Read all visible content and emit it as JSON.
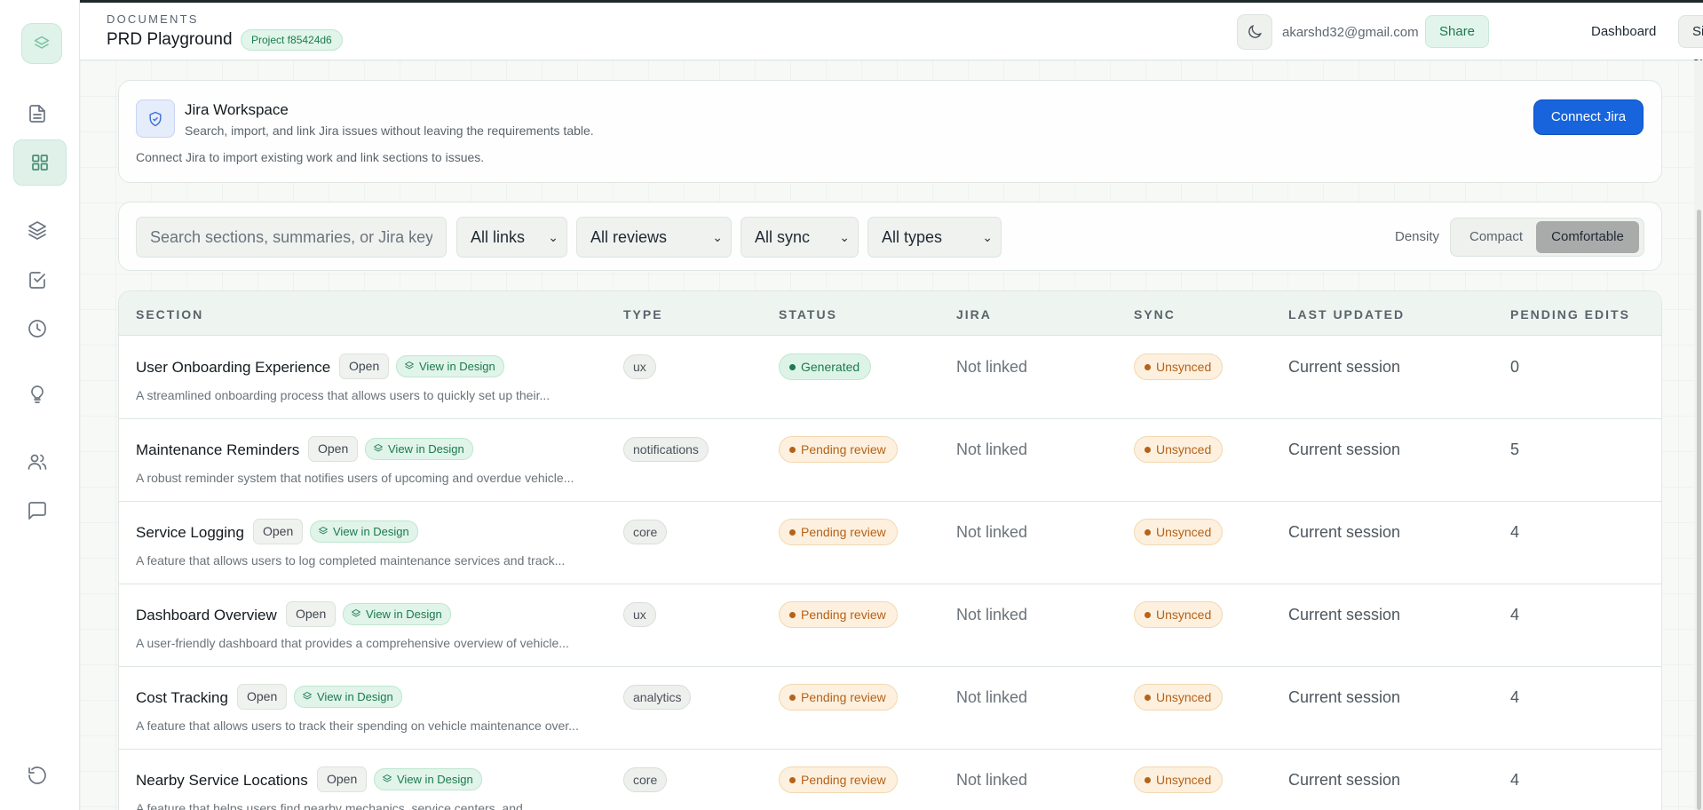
{
  "header": {
    "breadcrumb": "DOCUMENTS",
    "title": "PRD Playground",
    "project_badge": "Project f85424d6",
    "email": "akarshd32@gmail.com",
    "share_label": "Share",
    "dashboard_label": "Dashboard",
    "signout_label": "Sign out",
    "theme_icon": "moon-icon"
  },
  "sidebar": {
    "logo_icon": "layers-logo-icon",
    "items": [
      {
        "icon": "document-icon",
        "active": false
      },
      {
        "icon": "grid-icon",
        "active": true
      },
      {
        "icon": "layers-icon",
        "active": false
      },
      {
        "icon": "checklist-icon",
        "active": false
      },
      {
        "icon": "clock-icon",
        "active": false
      },
      {
        "icon": "lightbulb-icon",
        "active": false
      },
      {
        "icon": "users-icon",
        "active": false
      },
      {
        "icon": "chat-icon",
        "active": false
      },
      {
        "icon": "undo-icon",
        "active": false
      }
    ]
  },
  "jira": {
    "title": "Jira Workspace",
    "subtitle": "Search, import, and link Jira issues without leaving the requirements table.",
    "note": "Connect Jira to import existing work and link sections to issues.",
    "connect_label": "Connect Jira"
  },
  "filters": {
    "search_placeholder": "Search sections, summaries, or Jira keys",
    "links": "All links",
    "reviews": "All reviews",
    "sync": "All sync",
    "types": "All types",
    "density_label": "Density",
    "density_options": [
      "Compact",
      "Comfortable"
    ],
    "density_selected": "Comfortable"
  },
  "table": {
    "columns": [
      "SECTION",
      "TYPE",
      "STATUS",
      "JIRA",
      "SYNC",
      "LAST UPDATED",
      "PENDING EDITS"
    ],
    "open_label": "Open",
    "design_label": "View in Design",
    "rows": [
      {
        "title": "User Onboarding Experience",
        "summary": "A streamlined onboarding process that allows users to quickly set up their...",
        "type": "ux",
        "status": "Generated",
        "jira": "Not linked",
        "sync": "Unsynced",
        "updated": "Current session",
        "pending": "0"
      },
      {
        "title": "Maintenance Reminders",
        "summary": "A robust reminder system that notifies users of upcoming and overdue vehicle...",
        "type": "notifications",
        "status": "Pending review",
        "jira": "Not linked",
        "sync": "Unsynced",
        "updated": "Current session",
        "pending": "5"
      },
      {
        "title": "Service Logging",
        "summary": "A feature that allows users to log completed maintenance services and track...",
        "type": "core",
        "status": "Pending review",
        "jira": "Not linked",
        "sync": "Unsynced",
        "updated": "Current session",
        "pending": "4"
      },
      {
        "title": "Dashboard Overview",
        "summary": "A user-friendly dashboard that provides a comprehensive overview of vehicle...",
        "type": "ux",
        "status": "Pending review",
        "jira": "Not linked",
        "sync": "Unsynced",
        "updated": "Current session",
        "pending": "4"
      },
      {
        "title": "Cost Tracking",
        "summary": "A feature that allows users to track their spending on vehicle maintenance over...",
        "type": "analytics",
        "status": "Pending review",
        "jira": "Not linked",
        "sync": "Unsynced",
        "updated": "Current session",
        "pending": "4"
      },
      {
        "title": "Nearby Service Locations",
        "summary": "A feature that helps users find nearby mechanics, service centers, and...",
        "type": "core",
        "status": "Pending review",
        "jira": "Not linked",
        "sync": "Unsynced",
        "updated": "Current session",
        "pending": "4"
      }
    ]
  },
  "colors": {
    "accent": "#1764dc",
    "success": "#1c7a4c",
    "warning": "#b5621a"
  }
}
